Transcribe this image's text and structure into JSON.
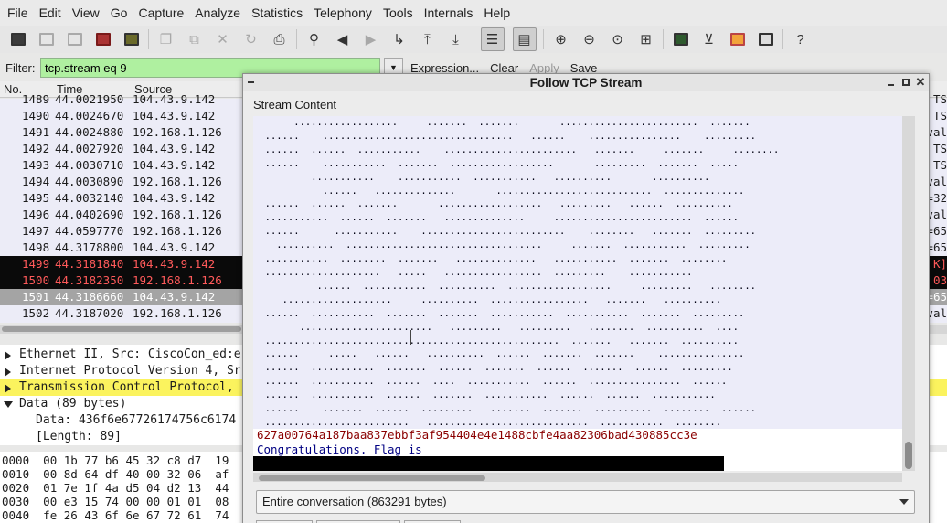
{
  "menubar": {
    "items": [
      "File",
      "Edit",
      "View",
      "Go",
      "Capture",
      "Analyze",
      "Statistics",
      "Telephony",
      "Tools",
      "Internals",
      "Help"
    ]
  },
  "toolbar": {
    "icons": [
      "list-interfaces-icon",
      "capture-options-icon",
      "start-capture-icon",
      "stop-capture-icon",
      "restart-capture-icon",
      "open-file-icon",
      "save-file-icon",
      "close-file-icon",
      "reload-icon",
      "print-icon",
      "find-packet-icon",
      "go-back-icon",
      "go-forward-icon",
      "go-to-packet-icon",
      "first-packet-icon",
      "last-packet-icon",
      "colorize-icon",
      "auto-scroll-icon",
      "zoom-in-icon",
      "zoom-out-icon",
      "normal-size-icon",
      "resize-columns-icon",
      "capture-filters-icon",
      "display-filters-icon",
      "coloring-rules-icon",
      "preferences-icon",
      "help-icon"
    ]
  },
  "filter": {
    "label": "Filter:",
    "value": "tcp.stream eq 9",
    "expression": "Expression...",
    "clear": "Clear",
    "apply": "Apply",
    "save": "Save",
    "input_color": "#aff0a0"
  },
  "packet_list": {
    "columns": [
      "No.",
      "Time",
      "Source"
    ],
    "rows": [
      {
        "no": "1489",
        "time": "44.0021950",
        "src": "104.43.9.142",
        "right": "TS"
      },
      {
        "no": "1490",
        "time": "44.0024670",
        "src": "104.43.9.142",
        "right": "TS"
      },
      {
        "no": "1491",
        "time": "44.0024880",
        "src": "192.168.1.126",
        "right": "val"
      },
      {
        "no": "1492",
        "time": "44.0027920",
        "src": "104.43.9.142",
        "right": "TS"
      },
      {
        "no": "1493",
        "time": "44.0030710",
        "src": "104.43.9.142",
        "right": "TS"
      },
      {
        "no": "1494",
        "time": "44.0030890",
        "src": "192.168.1.126",
        "right": "val"
      },
      {
        "no": "1495",
        "time": "44.0032140",
        "src": "104.43.9.142",
        "right": "=32"
      },
      {
        "no": "1496",
        "time": "44.0402690",
        "src": "192.168.1.126",
        "right": "val"
      },
      {
        "no": "1497",
        "time": "44.0597770",
        "src": "192.168.1.126",
        "right": "=65"
      },
      {
        "no": "1498",
        "time": "44.3178800",
        "src": "104.43.9.142",
        "right": "=65"
      },
      {
        "no": "1499",
        "time": "44.3181840",
        "src": "104.43.9.142",
        "right": "K]"
      },
      {
        "no": "1500",
        "time": "44.3182350",
        "src": "192.168.1.126",
        "right": "03"
      },
      {
        "no": "1501",
        "time": "44.3186660",
        "src": "104.43.9.142",
        "right": "=65"
      },
      {
        "no": "1502",
        "time": "44.3187020",
        "src": "192.168.1.126",
        "right": "val"
      }
    ],
    "black_row_color": "#0a0a0a",
    "black_row_text": "#ff5a5a",
    "selected_row_color": "#a4a4a4"
  },
  "details": {
    "rows": [
      {
        "text": "Ethernet II, Src: CiscoCon_ed:e"
      },
      {
        "text": "Internet Protocol Version 4, Sr"
      },
      {
        "text": "Transmission Control Protocol, "
      },
      {
        "text": "Data (89 bytes)"
      },
      {
        "text": "Data: 436f6e67726174756c6174"
      },
      {
        "text": "[Length: 89]"
      }
    ],
    "highlight_color": "#fbf35e"
  },
  "bytes": {
    "rows": [
      {
        "off": "0000",
        "hex": "00 1b 77 b6 45 32 c8 d7  19"
      },
      {
        "off": "0010",
        "hex": "00 8d 64 df 40 00 32 06  af"
      },
      {
        "off": "0020",
        "hex": "01 7e 1f 4a d5 04 d2 13  44"
      },
      {
        "off": "0030",
        "hex": "00 e3 15 74 00 00 01 01  08"
      },
      {
        "off": "0040",
        "hex": "fe 26 43 6f 6e 67 72 61  74"
      }
    ]
  },
  "dialog": {
    "title": "Follow TCP Stream",
    "stream_label": "Stream Content",
    "hex_line": "627a00764a187baa837ebbf3af954404e4e1488cbfe4aa82306bad430885cc3e",
    "congrats": "Congratulations. Flag is",
    "conversation": "Entire conversation (863291 bytes)",
    "hex_color": "#8a0000",
    "text_color": "#000082",
    "dot_lines": [
      "       ..................     .......  .......       ........................  .......",
      "  ......    .................................   ......    ................    .........",
      "  ......  ......  ...........    .......................   .......     .......     ........",
      "  ......    ...........  .......  ..................       .........  .......  .....",
      "          ...........    ...........  ...........   ..........       ..........",
      "            ......   ..............       ...........................  ..............",
      "  ......  ......  .......       ..................   .........   ......  ..........",
      "  ...........  ......  .......   ..............     ........................  ......",
      "  ......      ...........    .........................    ........   .......  .........",
      "    ..........  ..................................     .......  ...........  .........",
      "  ...........  ........  .......   ..............   ...........  .......  ........",
      "  ....................   .....   .................  .........    ...........",
      "           ......  ...........  ..........  ..................     .........   ........",
      "     ...................     ..........  .................   .......   ..........",
      "  ......  ...........  .......  .......  ...........  ...........  .......  .........",
      "        .......................   .........   .........   ........  ..........  ....",
      "  ...................................................  .......   .......  ..........",
      "  ......     .....   ......   ..........  ......  .......  .......    ...............",
      "  ......  ...........  .......  ......  .......  ......  .......  ......  .........",
      "  ......  ...........  ......  ....  ...........  ......  ................  ......",
      "  ......  ...........  ......  .......  ...........  ......  ......  ...........",
      "  ......    .......  ......  .........   .......  .......  ..........  ........  ......",
      "  .........................   ............................  ...........  ........"
    ]
  }
}
